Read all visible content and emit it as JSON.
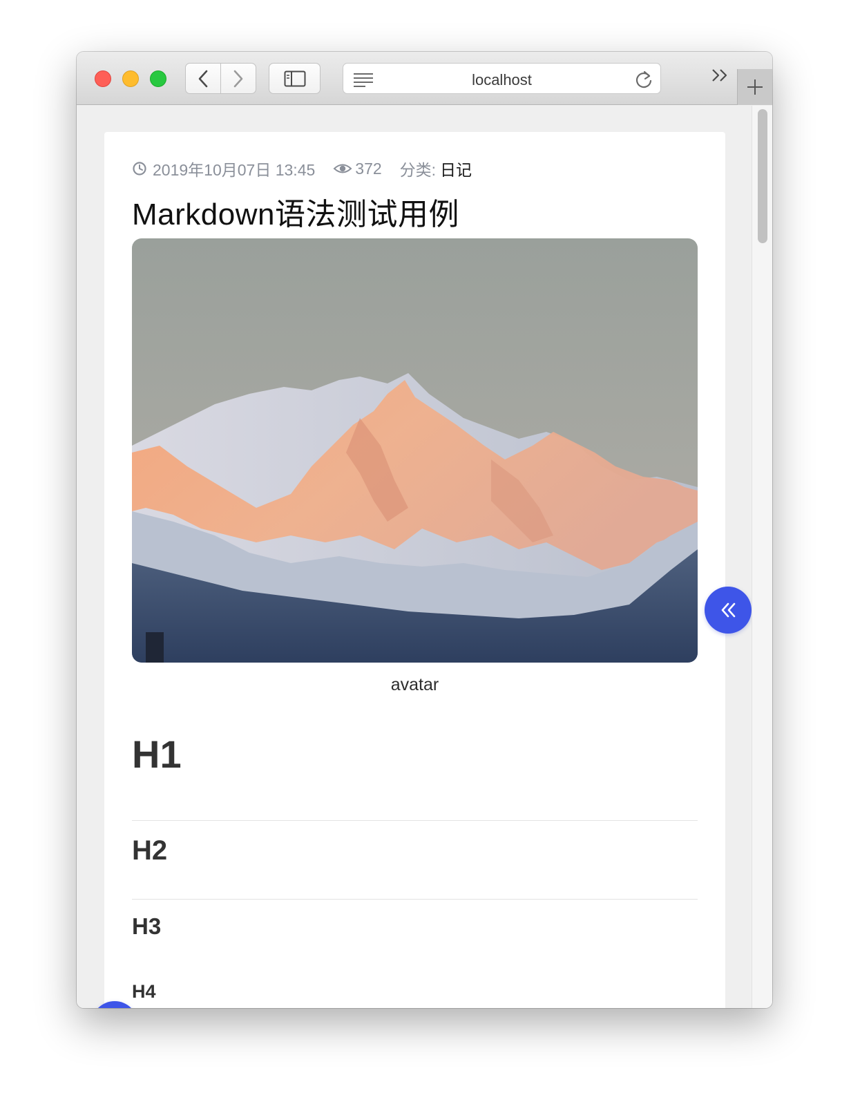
{
  "browser": {
    "address": "localhost",
    "colors": {
      "close": "#fe5f57",
      "minimize": "#febc2e",
      "zoom": "#28c840"
    }
  },
  "post": {
    "date": "2019年10月07日 13:45",
    "views": "372",
    "category_label": "分类:",
    "category": "日记",
    "title": "Markdown语法测试用例",
    "image_caption": "avatar",
    "headings": {
      "h1": "H1",
      "h2": "H2",
      "h3": "H3",
      "h4": "H4"
    }
  },
  "icons": {
    "date": "clock-icon",
    "views": "eye-icon",
    "collapse": "double-chevron-left-icon",
    "menu": "hamburger-menu-icon"
  },
  "theme": {
    "accent": "#3e55e8"
  }
}
